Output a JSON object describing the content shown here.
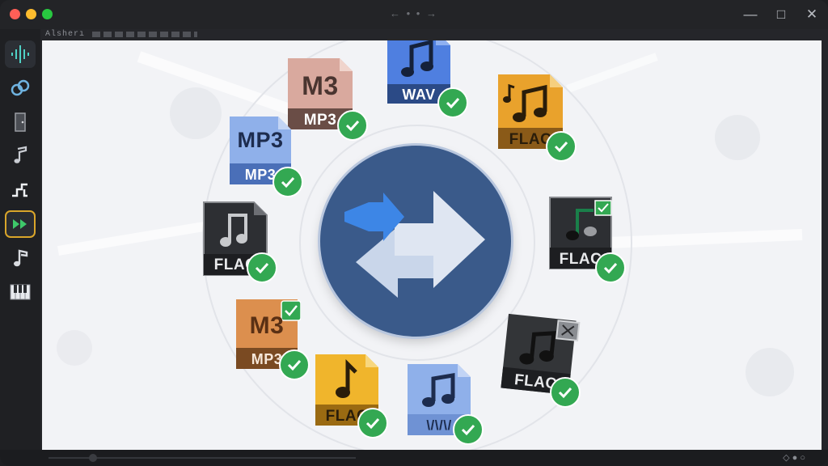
{
  "app": {
    "subtitle": "Alsherı",
    "title_glyphs": "← • • →",
    "window_controls": {
      "minimize": "—",
      "maximize": "□",
      "close": "✕"
    }
  },
  "sidebar": {
    "items": [
      {
        "name": "waveform-tool",
        "icon": "waveform-icon"
      },
      {
        "name": "link-tool",
        "icon": "link-icon"
      },
      {
        "name": "door-tool",
        "icon": "door-icon"
      },
      {
        "name": "music-note-tool",
        "icon": "music-note-icon"
      },
      {
        "name": "step-tool",
        "icon": "step-icon"
      },
      {
        "name": "fast-forward-tool",
        "icon": "fast-forward-icon",
        "selected": true
      },
      {
        "name": "note-tool",
        "icon": "music-note-icon"
      },
      {
        "name": "piano-tool",
        "icon": "piano-keys-icon"
      }
    ]
  },
  "files": [
    {
      "id": "wav-top",
      "big": "",
      "tag": "WAV",
      "status": "done"
    },
    {
      "id": "m3-top",
      "big": "M3",
      "tag": "MP3",
      "status": "done"
    },
    {
      "id": "flac-top-right",
      "big": "",
      "tag": "FLAC",
      "status": "done"
    },
    {
      "id": "mp3-left",
      "big": "MP3",
      "tag": "MP3",
      "status": "done"
    },
    {
      "id": "flac-left",
      "big": "",
      "tag": "FLAC",
      "status": "done"
    },
    {
      "id": "flac-right",
      "big": "",
      "tag": "FLAC",
      "status": "done"
    },
    {
      "id": "m3-bottom-left",
      "big": "M3",
      "tag": "MP3",
      "status": "done"
    },
    {
      "id": "flac-bottom-right",
      "big": "",
      "tag": "FLAC",
      "status": "done"
    },
    {
      "id": "flac-bottom",
      "big": "",
      "tag": "FLAC",
      "status": "done"
    },
    {
      "id": "wav-bottom",
      "big": "",
      "tag": "\\/\\/\\/",
      "status": "done"
    }
  ],
  "colors": {
    "hub": "#3a5a8a",
    "check": "#33a852",
    "wav_blue": "#4f7fe0",
    "flac_orange": "#e9a22c",
    "m3_pink": "#d9a99e",
    "mp3_blue": "#8fb0ea",
    "flac_dark": "#2d2f33",
    "m3_orange": "#dc8f4e",
    "flac_yellow": "#f0b52c"
  },
  "status": {
    "glyphs": "◇ ● ○"
  }
}
